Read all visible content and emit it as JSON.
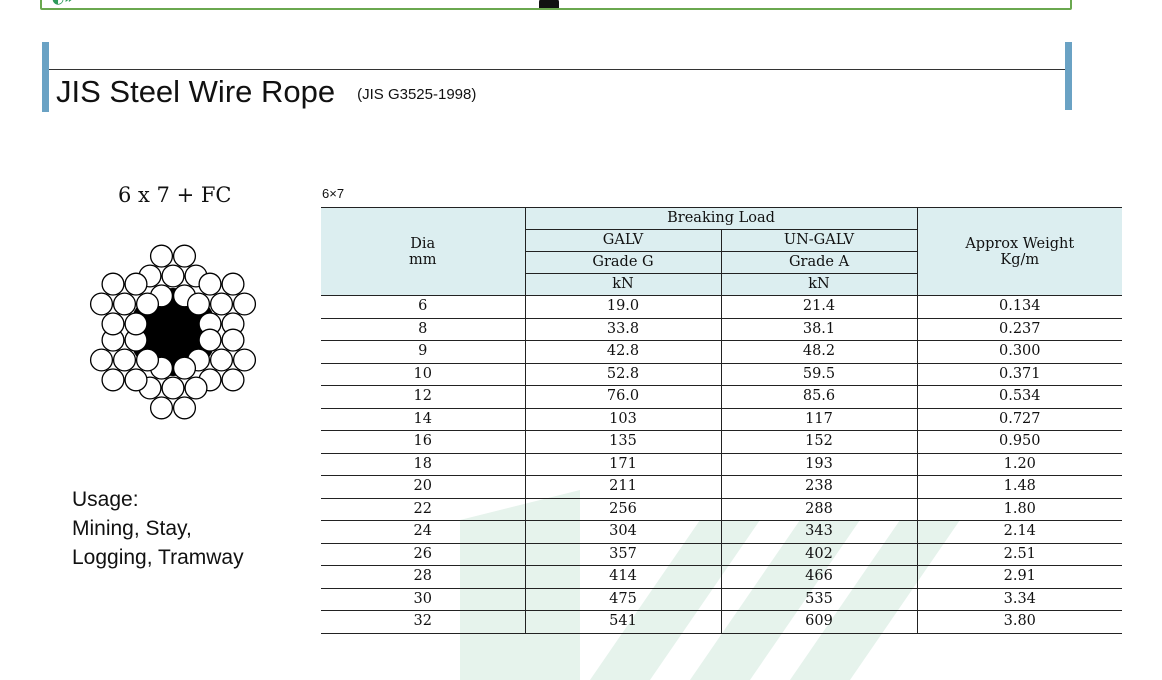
{
  "header": {
    "title": "JIS Steel Wire Rope",
    "standard": "(JIS G3525-1998)"
  },
  "rope": {
    "construction": "6 x 7 + FC"
  },
  "usage": {
    "heading": "Usage:",
    "lines": [
      "Mining, Stay,",
      "Logging, Tramway"
    ]
  },
  "table": {
    "label": "6×7",
    "headers": {
      "dia": "Dia",
      "dia_unit": "mm",
      "breaking_load": "Breaking Load",
      "galv": "GALV",
      "ungalv": "UN-GALV",
      "grade_g": "Grade G",
      "grade_a": "Grade A",
      "kn_1": "kN",
      "kn_2": "kN",
      "weight": "Approx Weight",
      "weight_unit": "Kg/m"
    },
    "rows": [
      {
        "dia": "6",
        "galv": "19.0",
        "ungalv": "21.4",
        "weight": "0.134"
      },
      {
        "dia": "8",
        "galv": "33.8",
        "ungalv": "38.1",
        "weight": "0.237"
      },
      {
        "dia": "9",
        "galv": "42.8",
        "ungalv": "48.2",
        "weight": "0.300"
      },
      {
        "dia": "10",
        "galv": "52.8",
        "ungalv": "59.5",
        "weight": "0.371"
      },
      {
        "dia": "12",
        "galv": "76.0",
        "ungalv": "85.6",
        "weight": "0.534"
      },
      {
        "dia": "14",
        "galv": "103",
        "ungalv": "117",
        "weight": "0.727"
      },
      {
        "dia": "16",
        "galv": "135",
        "ungalv": "152",
        "weight": "0.950"
      },
      {
        "dia": "18",
        "galv": "171",
        "ungalv": "193",
        "weight": "1.20"
      },
      {
        "dia": "20",
        "galv": "211",
        "ungalv": "238",
        "weight": "1.48"
      },
      {
        "dia": "22",
        "galv": "256",
        "ungalv": "288",
        "weight": "1.80"
      },
      {
        "dia": "24",
        "galv": "304",
        "ungalv": "343",
        "weight": "2.14"
      },
      {
        "dia": "26",
        "galv": "357",
        "ungalv": "402",
        "weight": "2.51"
      },
      {
        "dia": "28",
        "galv": "414",
        "ungalv": "466",
        "weight": "2.91"
      },
      {
        "dia": "30",
        "galv": "475",
        "ungalv": "535",
        "weight": "3.34"
      },
      {
        "dia": "32",
        "galv": "541",
        "ungalv": "609",
        "weight": "3.80"
      }
    ]
  },
  "colors": {
    "accent_bar": "#6aa2c4",
    "table_header_bg": "#dceef0",
    "banner_border": "#6aa84f"
  }
}
